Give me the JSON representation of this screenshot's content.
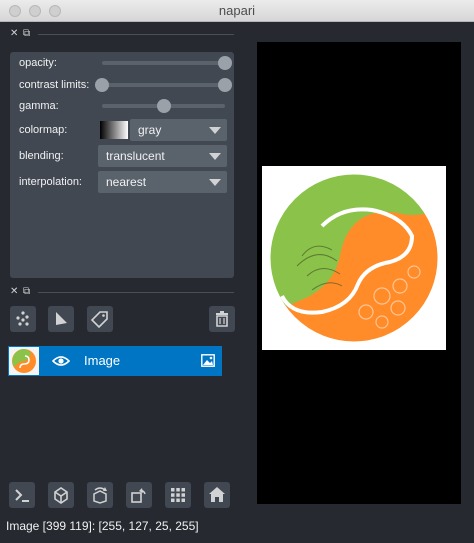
{
  "window": {
    "title": "napari"
  },
  "layer_controls": {
    "opacity": {
      "label": "opacity:",
      "value": 1.0
    },
    "contrast_limits": {
      "label": "contrast limits:",
      "range": [
        0.0,
        1.0
      ]
    },
    "gamma": {
      "label": "gamma:",
      "value": 0.5
    },
    "colormap": {
      "label": "colormap:",
      "value": "gray"
    },
    "blending": {
      "label": "blending:",
      "value": "translucent"
    },
    "interpolation": {
      "label": "interpolation:",
      "value": "nearest"
    }
  },
  "layer_buttons": {
    "icons": [
      "new-points-icon",
      "new-shapes-icon",
      "new-labels-icon",
      "delete-layer-icon"
    ]
  },
  "layers": [
    {
      "name": "Image",
      "visible": true,
      "selected": true
    }
  ],
  "viewer_buttons": {
    "icons": [
      "console-icon",
      "ndisplay-3d-icon",
      "roll-dims-icon",
      "transpose-icon",
      "grid-icon",
      "home-icon"
    ]
  },
  "status": {
    "text": "Image [399 119]: [255, 127, 25, 255]"
  },
  "colors": {
    "background": "#262930",
    "panel": "#414851",
    "accent": "#0075c4",
    "image_green": "#8bc34a",
    "image_orange": "#ff8c28"
  }
}
